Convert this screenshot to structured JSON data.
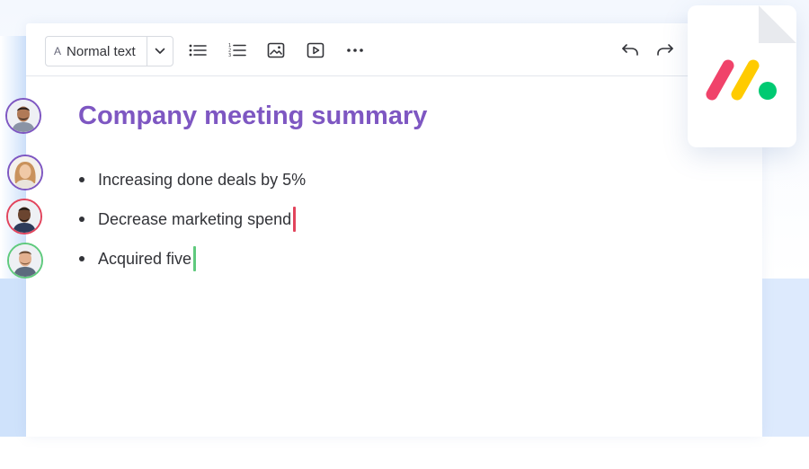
{
  "toolbar": {
    "style_select": {
      "icon": "A",
      "label": "Normal text"
    },
    "buttons": [
      {
        "name": "bulleted-list-icon"
      },
      {
        "name": "numbered-list-icon"
      },
      {
        "name": "image-icon"
      },
      {
        "name": "video-icon"
      },
      {
        "name": "more-icon"
      },
      {
        "name": "undo-icon"
      },
      {
        "name": "redo-icon"
      }
    ]
  },
  "document": {
    "title": "Company meeting summary",
    "bullets": [
      {
        "text": "Increasing done deals by 5%",
        "cursor": null
      },
      {
        "text": "Decrease marketing spend",
        "cursor": "#e2445c"
      },
      {
        "text": "Acquired five",
        "cursor": "#5fca7d"
      }
    ]
  },
  "collaborators": [
    {
      "name": "collaborator-1",
      "ring": "#7e57c2"
    },
    {
      "name": "collaborator-2",
      "ring": "#7e57c2"
    },
    {
      "name": "collaborator-3",
      "ring": "#e2445c"
    },
    {
      "name": "collaborator-4",
      "ring": "#5fca7d"
    }
  ],
  "colors": {
    "title": "#7e57c2",
    "text": "#323338",
    "logo_red": "#f0436a",
    "logo_yellow": "#ffcb00",
    "logo_green": "#00ca72"
  },
  "file_card": {
    "logo": "monday-logo-icon"
  }
}
